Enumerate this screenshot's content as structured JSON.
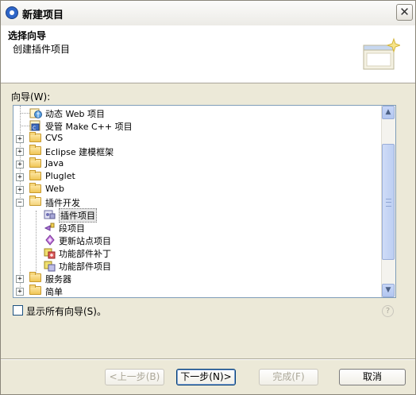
{
  "window": {
    "title": "新建项目",
    "close_label": "✕"
  },
  "header": {
    "title": "选择向导",
    "description": "创建插件项目"
  },
  "wizards": {
    "label": "向导(W):",
    "items": [
      {
        "label": "动态 Web 项目",
        "icon": "web-project-icon"
      },
      {
        "label": "受管 Make C++ 项目",
        "icon": "cpp-project-icon"
      },
      {
        "label": "CVS",
        "icon": "folder-icon"
      },
      {
        "label": "Eclipse 建模框架",
        "icon": "folder-icon"
      },
      {
        "label": "Java",
        "icon": "folder-icon"
      },
      {
        "label": "Pluglet",
        "icon": "folder-icon"
      },
      {
        "label": "Web",
        "icon": "folder-icon"
      },
      {
        "label": "插件开发",
        "icon": "folder-icon"
      },
      {
        "label": "插件项目",
        "icon": "plugin-project-icon"
      },
      {
        "label": "段项目",
        "icon": "fragment-project-icon"
      },
      {
        "label": "更新站点项目",
        "icon": "update-site-icon"
      },
      {
        "label": "功能部件补丁",
        "icon": "feature-patch-icon"
      },
      {
        "label": "功能部件项目",
        "icon": "feature-project-icon"
      },
      {
        "label": "服务器",
        "icon": "folder-icon"
      },
      {
        "label": "简单",
        "icon": "folder-icon"
      }
    ]
  },
  "show_all": {
    "label": "显示所有向导(S)。",
    "checked": false
  },
  "buttons": {
    "back": "<上一步(B)",
    "next": "下一步(N)>",
    "finish": "完成(F)",
    "cancel": "取消"
  }
}
